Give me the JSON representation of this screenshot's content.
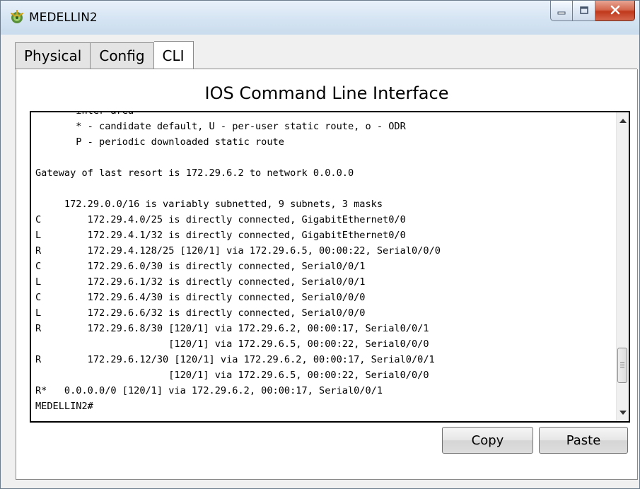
{
  "window": {
    "title": "MEDELLIN2"
  },
  "tabs": [
    {
      "label": "Physical"
    },
    {
      "label": "Config"
    },
    {
      "label": "CLI"
    }
  ],
  "active_tab": "CLI",
  "heading": "IOS Command Line Interface",
  "console": {
    "lines": [
      "       inter area",
      "       * - candidate default, U - per-user static route, o - ODR",
      "       P - periodic downloaded static route",
      "",
      "Gateway of last resort is 172.29.6.2 to network 0.0.0.0",
      "",
      "     172.29.0.0/16 is variably subnetted, 9 subnets, 3 masks",
      "C        172.29.4.0/25 is directly connected, GigabitEthernet0/0",
      "L        172.29.4.1/32 is directly connected, GigabitEthernet0/0",
      "R        172.29.4.128/25 [120/1] via 172.29.6.5, 00:00:22, Serial0/0/0",
      "C        172.29.6.0/30 is directly connected, Serial0/0/1",
      "L        172.29.6.1/32 is directly connected, Serial0/0/1",
      "C        172.29.6.4/30 is directly connected, Serial0/0/0",
      "L        172.29.6.6/32 is directly connected, Serial0/0/0",
      "R        172.29.6.8/30 [120/1] via 172.29.6.2, 00:00:17, Serial0/0/1",
      "                       [120/1] via 172.29.6.5, 00:00:22, Serial0/0/0",
      "R        172.29.6.12/30 [120/1] via 172.29.6.2, 00:00:17, Serial0/0/1",
      "                       [120/1] via 172.29.6.5, 00:00:22, Serial0/0/0",
      "R*   0.0.0.0/0 [120/1] via 172.29.6.2, 00:00:17, Serial0/0/1",
      "MEDELLIN2#"
    ]
  },
  "buttons": {
    "copy": "Copy",
    "paste": "Paste"
  },
  "icons": {
    "app": "router-app-icon",
    "minimize": "minimize-icon",
    "maximize": "maximize-icon",
    "close": "close-icon"
  },
  "colors": {
    "close_button": "#c9452a",
    "title_bar": "#d8e6f4",
    "console_border": "#000000"
  }
}
